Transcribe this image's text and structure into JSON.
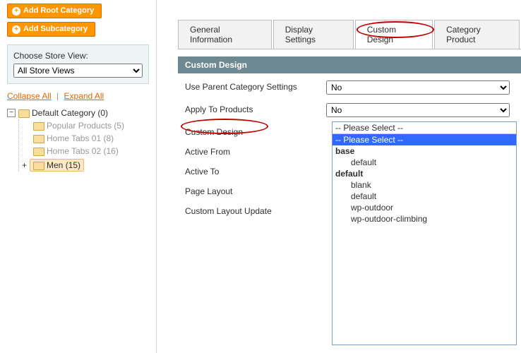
{
  "sidebar": {
    "add_root": "Add Root Category",
    "add_sub": "Add Subcategory",
    "store_view_label": "Choose Store View:",
    "store_view_value": "All Store Views",
    "collapse": "Collapse All",
    "expand": "Expand All",
    "tree": {
      "root": "Default Category (0)",
      "c1": "Popular Products (5)",
      "c2": "Home Tabs 01 (8)",
      "c3": "Home Tabs 02 (16)",
      "c4": "Men (15)"
    }
  },
  "tabs": {
    "t1": "General Information",
    "t2": "Display Settings",
    "t3": "Custom Design",
    "t4": "Category Product"
  },
  "section_title": "Custom Design",
  "form": {
    "r1": {
      "label": "Use Parent Category Settings",
      "value": "No"
    },
    "r2": {
      "label": "Apply To Products",
      "value": "No"
    },
    "r3": {
      "label": "Custom Design"
    },
    "r4": {
      "label": "Active From"
    },
    "r5": {
      "label": "Active To"
    },
    "r6": {
      "label": "Page Layout"
    },
    "r7": {
      "label": "Custom Layout Update"
    }
  },
  "dropdown": {
    "display": "-- Please Select --",
    "o1": "-- Please Select --",
    "g1": "base",
    "o2": "default",
    "g2": "default",
    "o3": "blank",
    "o4": "default",
    "o5": "wp-outdoor",
    "o6": "wp-outdoor-climbing"
  }
}
